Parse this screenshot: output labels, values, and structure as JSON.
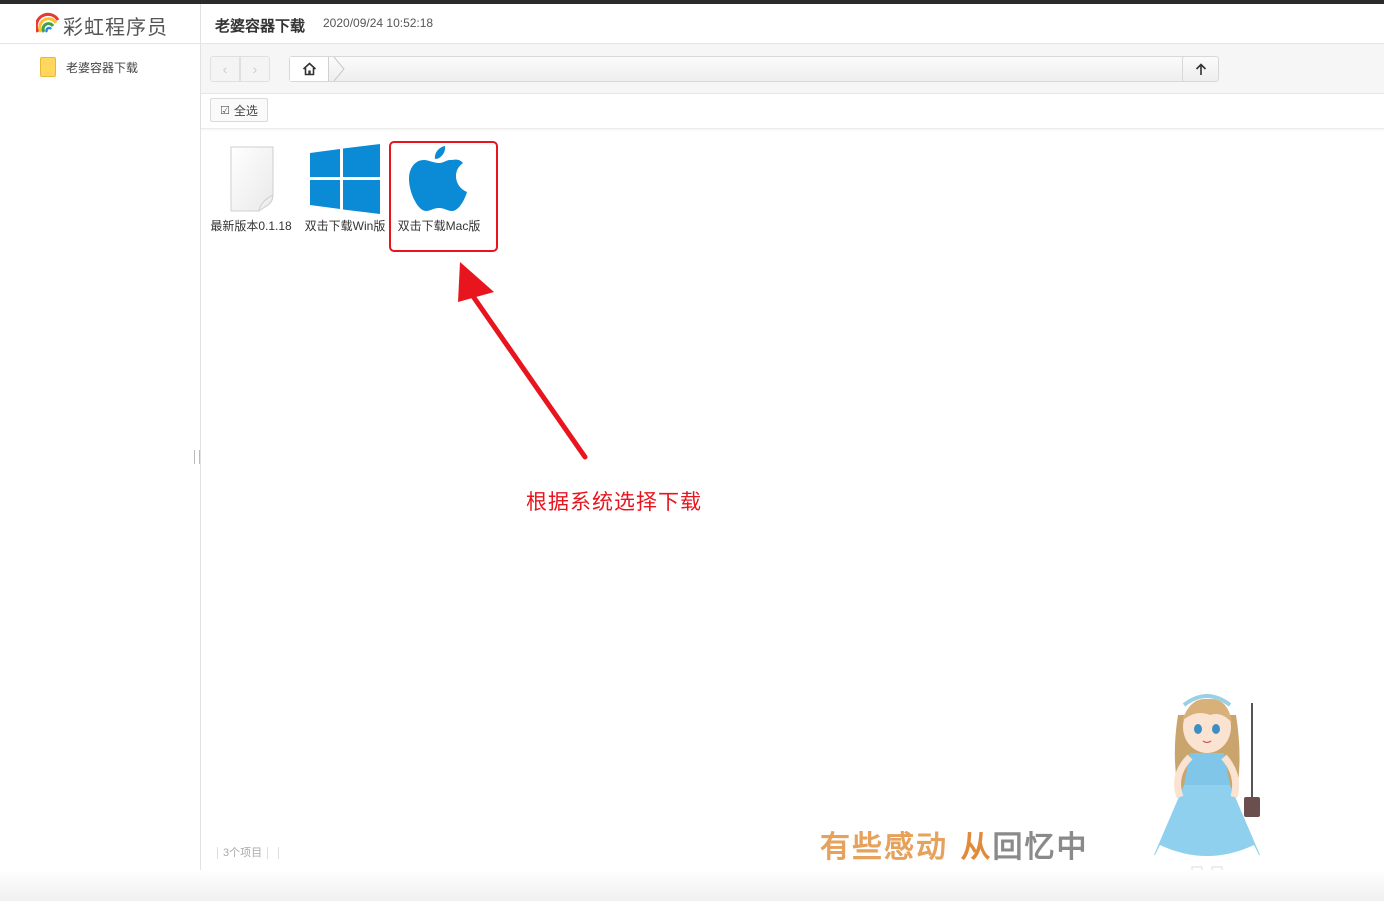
{
  "brand": {
    "name": "彩虹程序员",
    "logo_icon": "rainbow-icon"
  },
  "sidebar": {
    "items": [
      {
        "label": "老婆容器下载",
        "icon": "folder-icon"
      }
    ]
  },
  "header": {
    "title": "老婆容器下载",
    "timestamp": "2020/09/24 10:52:18"
  },
  "toolbar": {
    "back_icon": "chevron-left-icon",
    "forward_icon": "chevron-right-icon",
    "home_icon": "home-icon",
    "up_icon": "arrow-up-icon"
  },
  "actions": {
    "select_all_label": "全选"
  },
  "files": [
    {
      "name": "最新版本0.1.18",
      "icon": "document-icon"
    },
    {
      "name": "双击下载Win版",
      "icon": "windows-logo-icon"
    },
    {
      "name": "双击下载Mac版",
      "icon": "apple-logo-icon"
    }
  ],
  "annotation": {
    "text": "根据系统选择下载",
    "color": "#e8141e"
  },
  "status": {
    "item_count": "3个项目"
  },
  "widget": {
    "text_part1": "有些感动 ",
    "text_part2": "从",
    "text_part3": "回忆中"
  }
}
